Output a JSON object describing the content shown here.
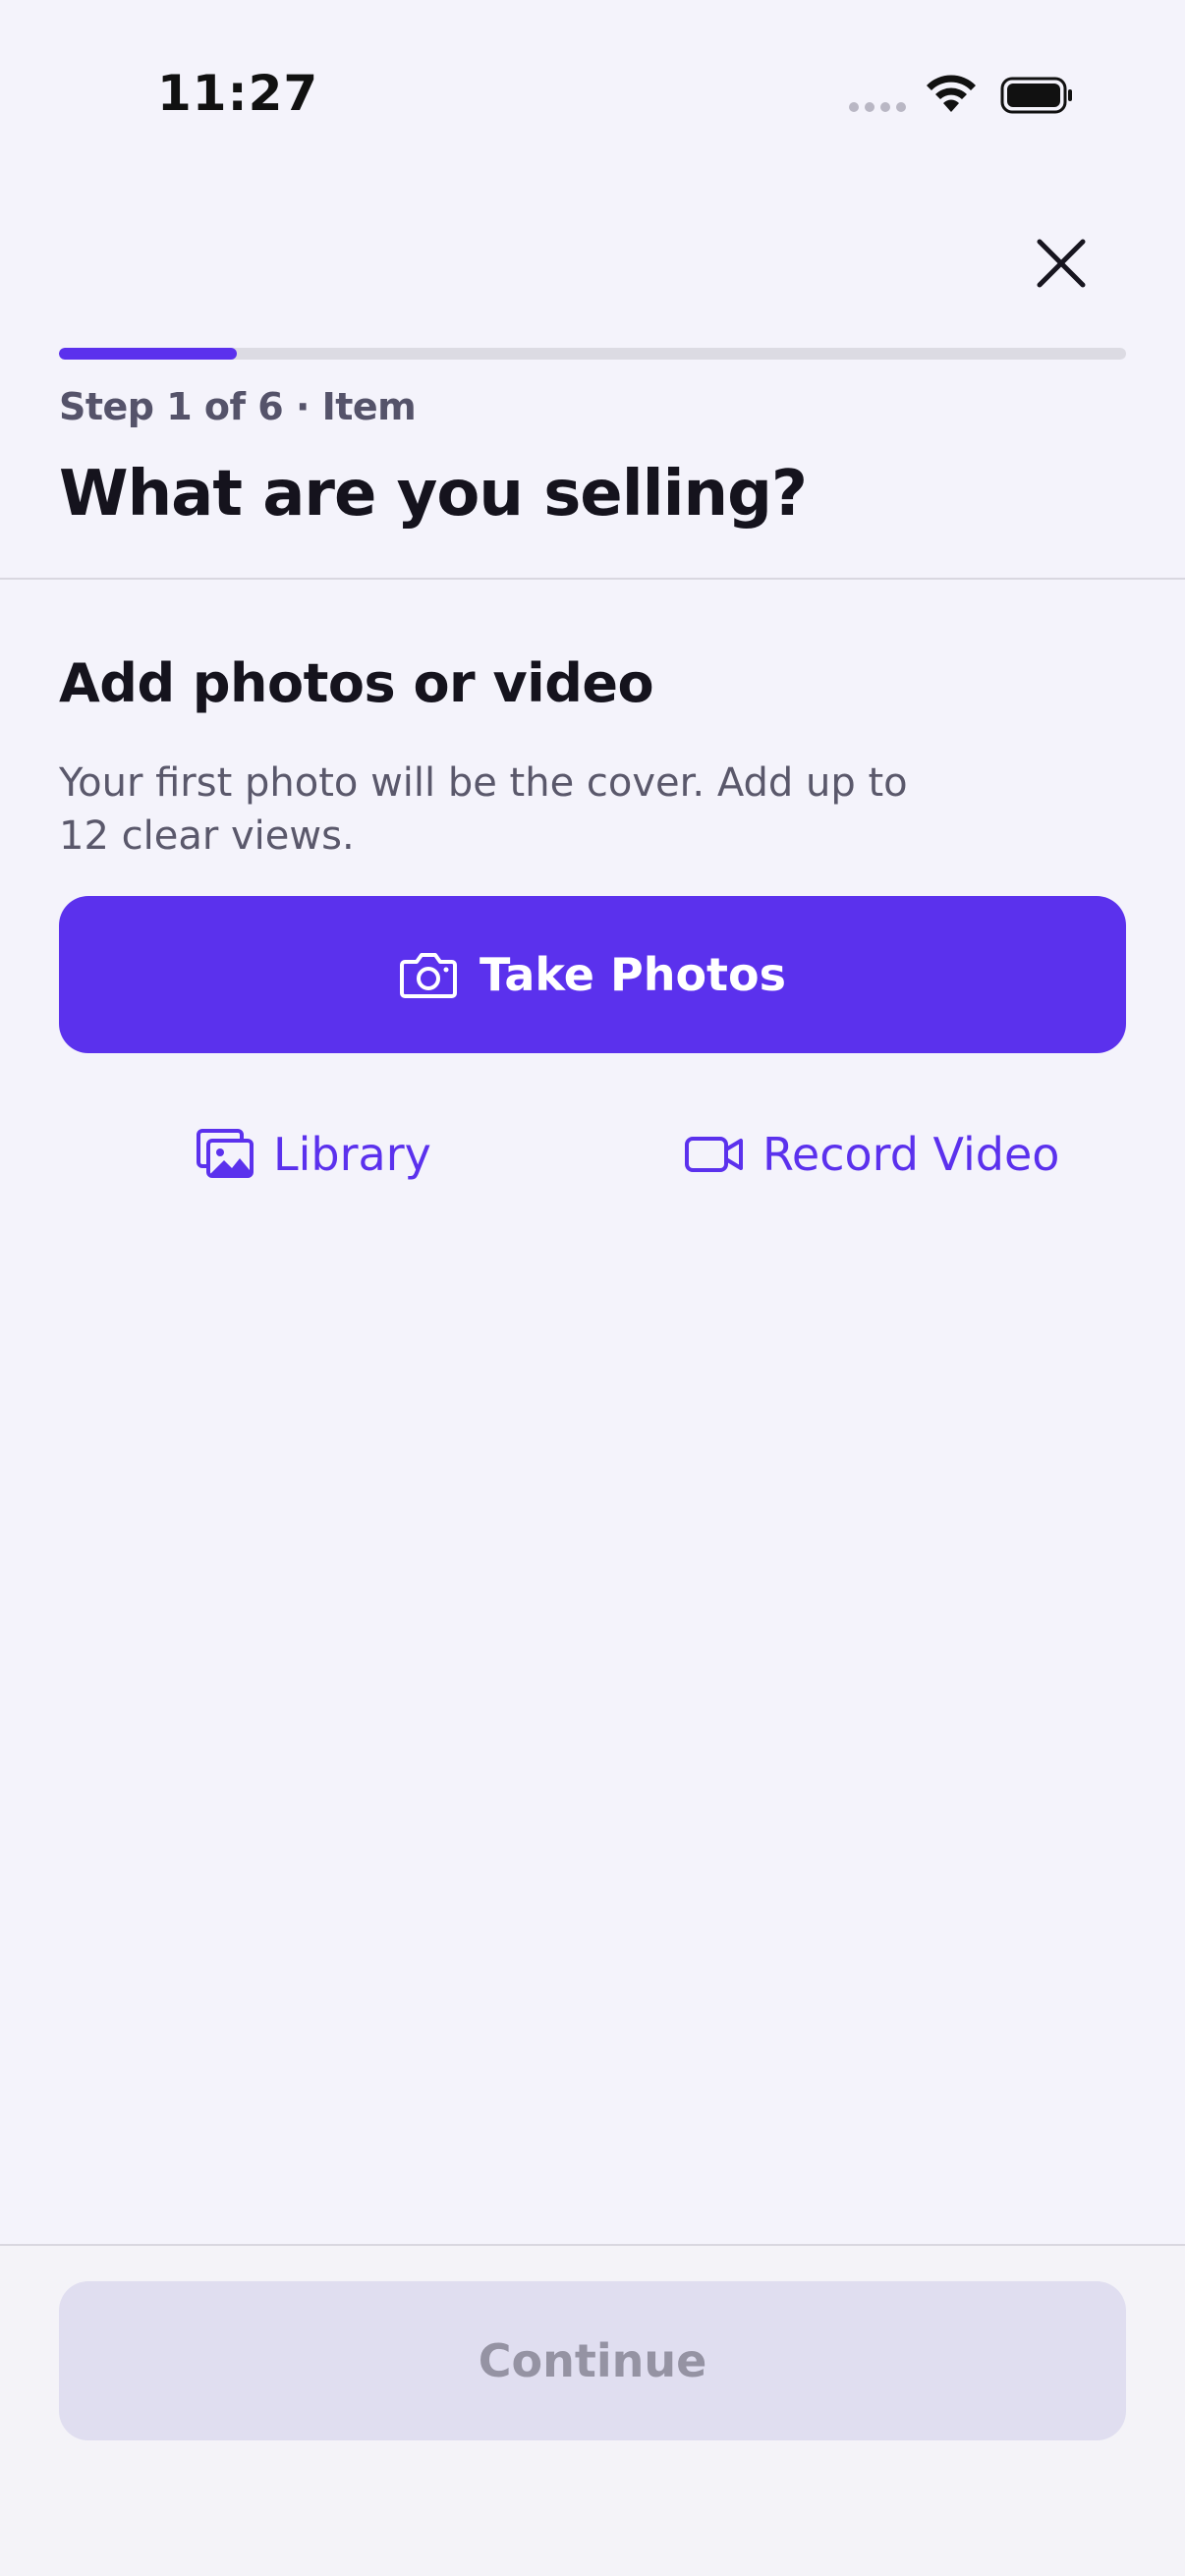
{
  "status_bar": {
    "time": "11:27"
  },
  "header": {
    "progress_fraction": 0.1667,
    "step_label": "Step 1 of 6 · Item",
    "title": "What are you selling?"
  },
  "media_section": {
    "title": "Add photos or video",
    "description": "Your first photo will be the cover. Add up to 12 clear views.",
    "take_photos_label": "Take Photos",
    "library_label": "Library",
    "record_video_label": "Record Video"
  },
  "footer": {
    "continue_label": "Continue"
  },
  "colors": {
    "accent": "#5b31ed",
    "background": "#f4f3fb",
    "disabled_button": "#e0def0"
  },
  "icons": {
    "close": "close-icon",
    "camera": "camera-icon",
    "library": "photo-library-icon",
    "video": "video-camera-icon"
  }
}
